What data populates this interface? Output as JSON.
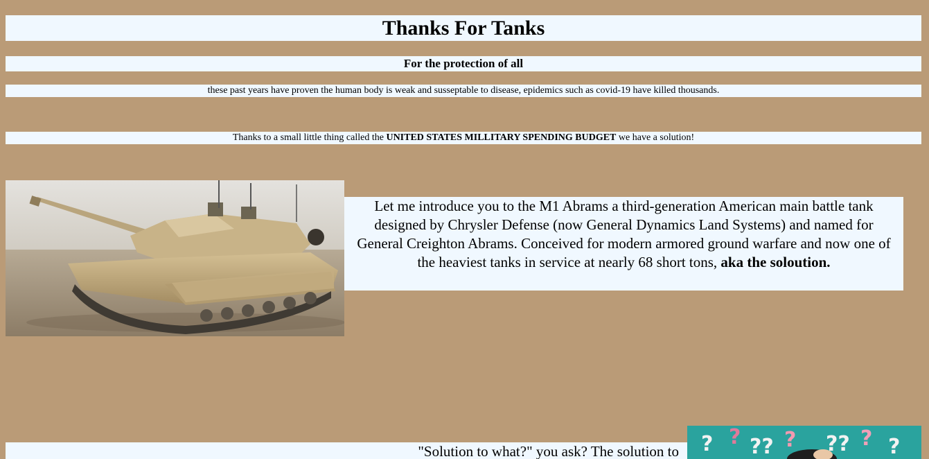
{
  "header": {
    "title": "Thanks For Tanks",
    "subtitle": "For the protection of all"
  },
  "intro": {
    "text": "these past years have proven the human body is weak and susseptable to disease, epidemics such as covid-19 have killed thousands."
  },
  "budget": {
    "prefix": "Thanks to a small little thing called the ",
    "emphasis": "UNITED STATES MILLITARY SPENDING BUDGET",
    "suffix": " we have a solution!"
  },
  "tank_section": {
    "text": "Let me introduce you to the M1 Abrams a third-generation American main battle tank designed by Chrysler Defense (now General Dynamics Land Systems) and named for General Creighton Abrams. Conceived for modern armored ground warfare and now one of the heaviest tanks in service at nearly 68 short tons, ",
    "emphasis": "aka the soloution."
  },
  "solution_section": {
    "text": "\"Solution to what?\" you ask? The solution to"
  },
  "images": {
    "tank": "m1-abrams-tank-photo",
    "question": "question-marks-photo"
  },
  "colors": {
    "page_background": "#ba9b77",
    "content_background": "#f0f8ff"
  }
}
